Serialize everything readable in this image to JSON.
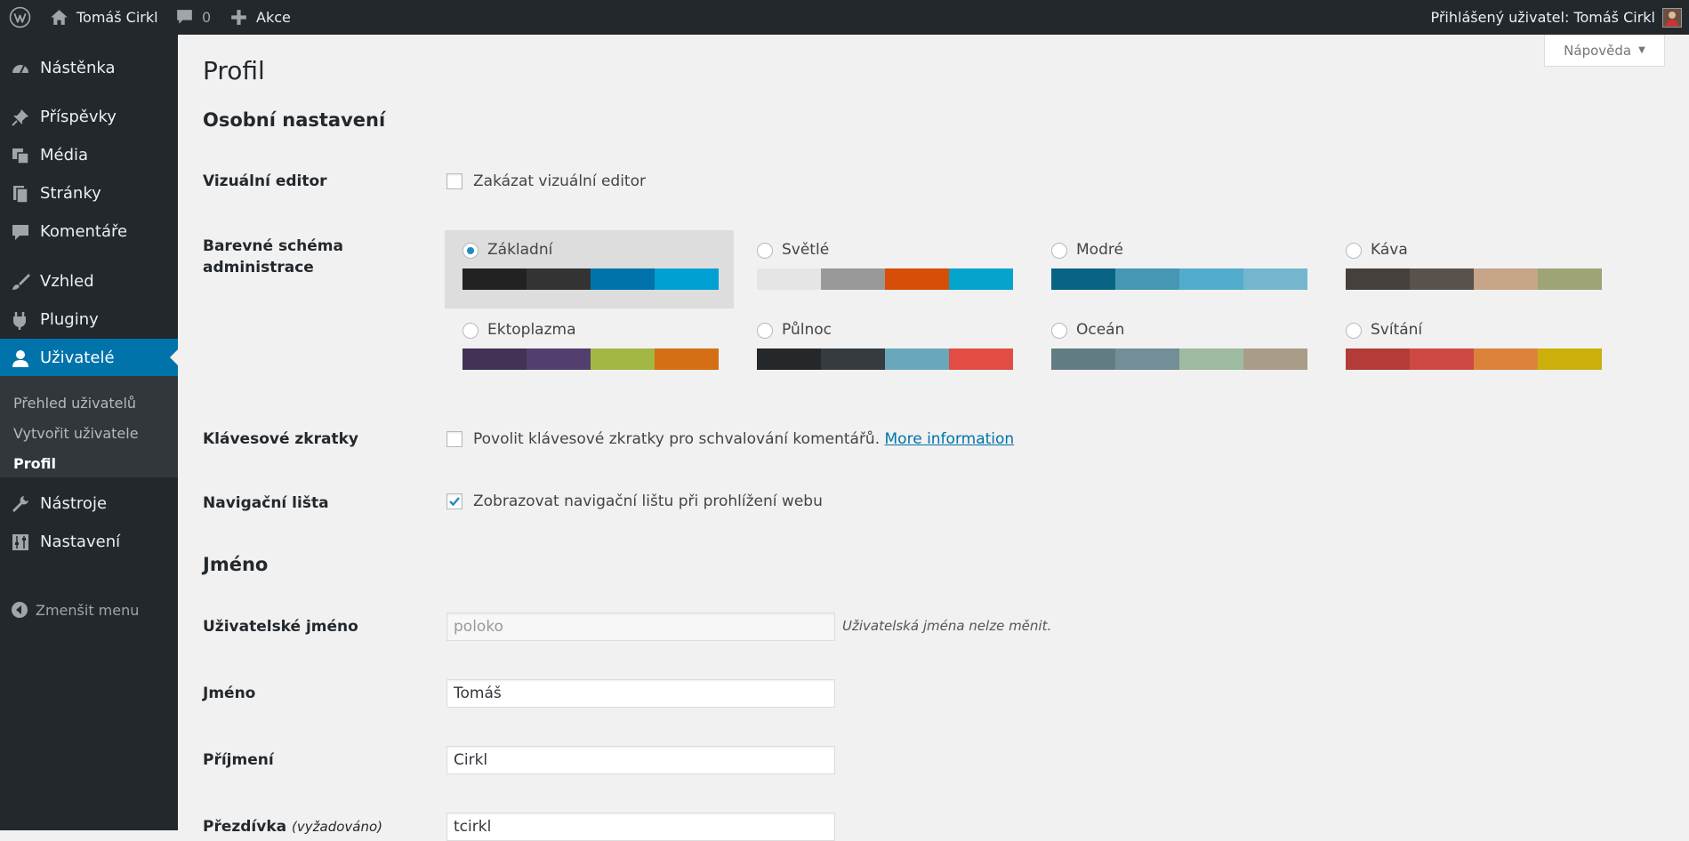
{
  "adminbar": {
    "site_name": "Tomáš Cirkl",
    "comments_count": "0",
    "new_label": "Akce",
    "account": "Přihlášený uživatel: Tomáš Cirkl"
  },
  "sidebar": {
    "items": [
      {
        "label": "Nástěnka",
        "icon": "dashboard-icon"
      },
      {
        "label": "Příspěvky",
        "icon": "pin-icon"
      },
      {
        "label": "Média",
        "icon": "media-icon"
      },
      {
        "label": "Stránky",
        "icon": "pages-icon"
      },
      {
        "label": "Komentáře",
        "icon": "comment-icon"
      },
      {
        "label": "Vzhled",
        "icon": "brush-icon"
      },
      {
        "label": "Pluginy",
        "icon": "plugin-icon"
      },
      {
        "label": "Uživatelé",
        "icon": "user-icon"
      },
      {
        "label": "Nástroje",
        "icon": "wrench-icon"
      },
      {
        "label": "Nastavení",
        "icon": "settings-icon"
      }
    ],
    "submenu": [
      "Přehled uživatelů",
      "Vytvořit uživatele",
      "Profil"
    ],
    "collapse_label": "Zmenšit menu"
  },
  "help_tab": {
    "label": "Nápověda"
  },
  "page": {
    "title": "Profil",
    "section_personal": "Osobní nastavení",
    "visual_editor": {
      "label": "Vizuální editor",
      "checkbox_label": "Zakázat vizuální editor",
      "checked": false
    },
    "color_scheme": {
      "label_line1": "Barevné schéma",
      "label_line2": "administrace",
      "schemes": [
        {
          "name": "Základní",
          "selected": true,
          "colors": [
            "#222222",
            "#333333",
            "#0073aa",
            "#00a0d2"
          ]
        },
        {
          "name": "Světlé",
          "selected": false,
          "colors": [
            "#e5e5e5",
            "#999999",
            "#d64e07",
            "#04a4cc"
          ]
        },
        {
          "name": "Modré",
          "selected": false,
          "colors": [
            "#096484",
            "#4796b3",
            "#52accc",
            "#74b6ce"
          ]
        },
        {
          "name": "Káva",
          "selected": false,
          "colors": [
            "#46403c",
            "#59524c",
            "#c7a589",
            "#9ea476"
          ]
        },
        {
          "name": "Ektoplazma",
          "selected": false,
          "colors": [
            "#413256",
            "#523f6d",
            "#a3b745",
            "#d46f15"
          ]
        },
        {
          "name": "Půlnoc",
          "selected": false,
          "colors": [
            "#25282b",
            "#363b3f",
            "#69a8bb",
            "#e14d43"
          ]
        },
        {
          "name": "Oceán",
          "selected": false,
          "colors": [
            "#627c83",
            "#738e96",
            "#9ebaa0",
            "#aa9d88"
          ]
        },
        {
          "name": "Svítání",
          "selected": false,
          "colors": [
            "#b43c38",
            "#cf4944",
            "#dd823b",
            "#ccaf0b"
          ]
        }
      ]
    },
    "keyboard": {
      "label": "Klávesové zkratky",
      "checkbox_label": "Povolit klávesové zkratky pro schvalování komentářů.",
      "link": "More information",
      "checked": false
    },
    "toolbar": {
      "label": "Navigační lišta",
      "checkbox_label": "Zobrazovat navigační lištu při prohlížení webu",
      "checked": true
    },
    "section_name": "Jméno",
    "username": {
      "label": "Uživatelské jméno",
      "value": "poloko",
      "description": "Uživatelská jména nelze měnit."
    },
    "first_name": {
      "label": "Jméno",
      "value": "Tomáš"
    },
    "last_name": {
      "label": "Příjmení",
      "value": "Cirkl"
    },
    "nickname": {
      "label": "Přezdívka",
      "required": "(vyžadováno)",
      "value": "tcirkl"
    }
  }
}
